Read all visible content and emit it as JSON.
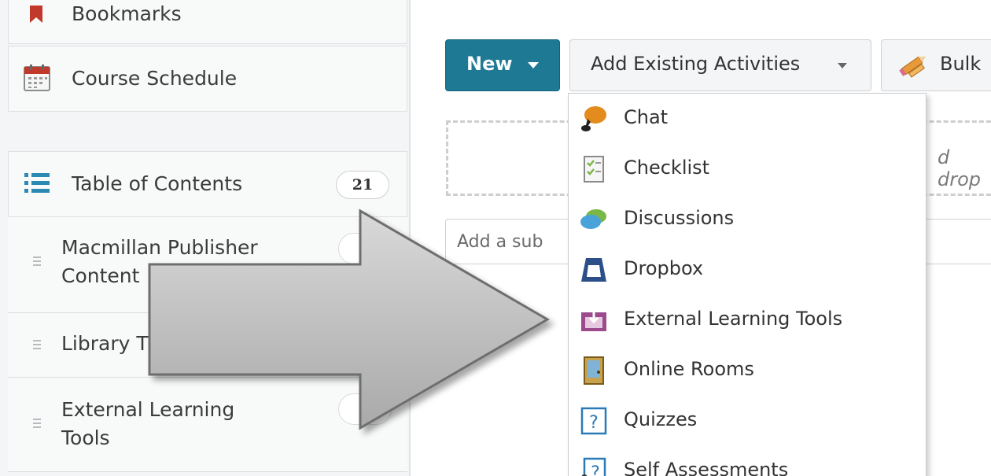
{
  "sidebar": {
    "bookmarks": {
      "label": "Bookmarks",
      "icon": "bookmark-icon"
    },
    "course_schedule": {
      "label": "Course Schedule",
      "icon": "calendar-icon"
    },
    "toc": {
      "label": "Table of Contents",
      "count": "21",
      "icon": "list-icon"
    },
    "modules": [
      {
        "label_line1": "Macmillan Publisher",
        "label_line2": "Content"
      },
      {
        "label_line1": "Library T",
        "label_line2": ""
      },
      {
        "label_line1": "External Learning",
        "label_line2": "Tools"
      }
    ]
  },
  "toolbar": {
    "new_label": "New",
    "add_existing_label": "Add Existing Activities",
    "bulk_label": "Bulk"
  },
  "dropzone": {
    "text": "d drop"
  },
  "subinput": {
    "placeholder": "Add a sub"
  },
  "menu": {
    "items": [
      {
        "label": "Chat",
        "icon": "chat-icon",
        "color": "#e38b1c"
      },
      {
        "label": "Checklist",
        "icon": "checklist-icon",
        "color": "#7ab648"
      },
      {
        "label": "Discussions",
        "icon": "discussions-icon",
        "color": "#4aa3d8"
      },
      {
        "label": "Dropbox",
        "icon": "dropbox-icon",
        "color": "#2c4f8a"
      },
      {
        "label": "External Learning Tools",
        "icon": "external-tools-icon",
        "color": "#9b4a8c"
      },
      {
        "label": "Online Rooms",
        "icon": "online-rooms-icon",
        "color": "#c8a24a"
      },
      {
        "label": "Quizzes",
        "icon": "quizzes-icon",
        "color": "#2a7ab8"
      },
      {
        "label": "Self Assessments",
        "icon": "self-assessments-icon",
        "color": "#2a7ab8"
      }
    ]
  },
  "colors": {
    "primary": "#1e7a94",
    "bookmark": "#c0392b",
    "toc_icon": "#2a8ab3"
  }
}
